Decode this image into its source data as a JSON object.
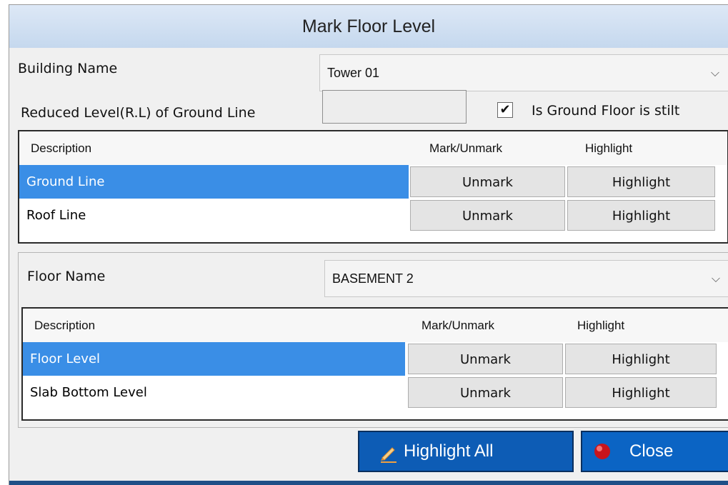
{
  "dialog": {
    "title": "Mark Floor Level"
  },
  "building": {
    "label": "Building Name",
    "selected": "Tower 01",
    "rl_label": "Reduced Level(R.L) of Ground Line",
    "rl_value": "",
    "stilt_checked": true,
    "stilt_label": "Is Ground Floor is stilt"
  },
  "grid1": {
    "headers": [
      "Description",
      "Mark/Unmark",
      "Highlight"
    ],
    "rows": [
      {
        "description": "Ground Line",
        "mark": "Unmark",
        "highlight": "Highlight",
        "selected": true
      },
      {
        "description": "Roof Line",
        "mark": "Unmark",
        "highlight": "Highlight",
        "selected": false
      }
    ]
  },
  "floor": {
    "label": "Floor Name",
    "selected": "BASEMENT 2"
  },
  "grid2": {
    "headers": [
      "Description",
      "Mark/Unmark",
      "Highlight"
    ],
    "rows": [
      {
        "description": "Floor Level",
        "mark": "Unmark",
        "highlight": "Highlight",
        "selected": true
      },
      {
        "description": "Slab Bottom Level",
        "mark": "Unmark",
        "highlight": "Highlight",
        "selected": false
      }
    ]
  },
  "buttons": {
    "highlight_all": "Highlight All",
    "close": "Close"
  },
  "colors": {
    "selection": "#3a8ee6",
    "button_blue": "#0b5fb8",
    "title_bar": "#cfdff2"
  },
  "icons": {
    "checkbox": "check-mark",
    "highlight_all": "pencil-icon",
    "close": "red-ball-icon",
    "dropdown": "chevron-down-icon"
  }
}
